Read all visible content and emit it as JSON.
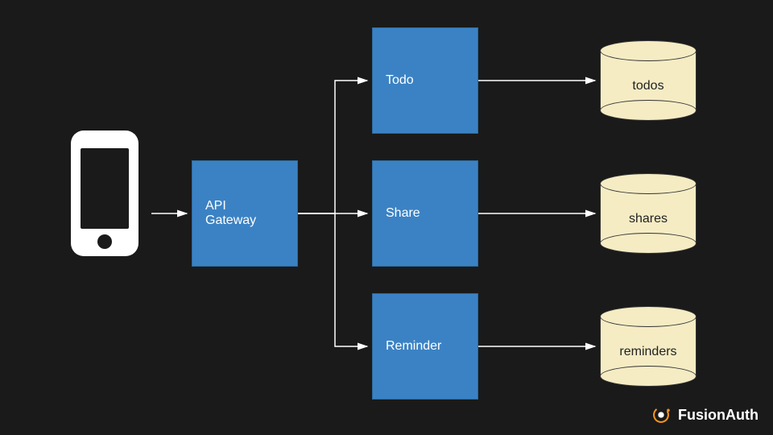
{
  "diagram": {
    "nodes": {
      "client": {
        "type": "mobile-device"
      },
      "gateway": {
        "label": "API\nGateway"
      },
      "todo": {
        "label": "Todo"
      },
      "share": {
        "label": "Share"
      },
      "reminder": {
        "label": "Reminder"
      }
    },
    "datastores": {
      "todos": {
        "label": "todos"
      },
      "shares": {
        "label": "shares"
      },
      "reminders": {
        "label": "reminders"
      }
    },
    "edges": [
      [
        "client",
        "gateway"
      ],
      [
        "gateway",
        "todo"
      ],
      [
        "gateway",
        "share"
      ],
      [
        "gateway",
        "reminder"
      ],
      [
        "todo",
        "todos"
      ],
      [
        "share",
        "shares"
      ],
      [
        "reminder",
        "reminders"
      ]
    ]
  },
  "branding": {
    "name": "FusionAuth"
  }
}
